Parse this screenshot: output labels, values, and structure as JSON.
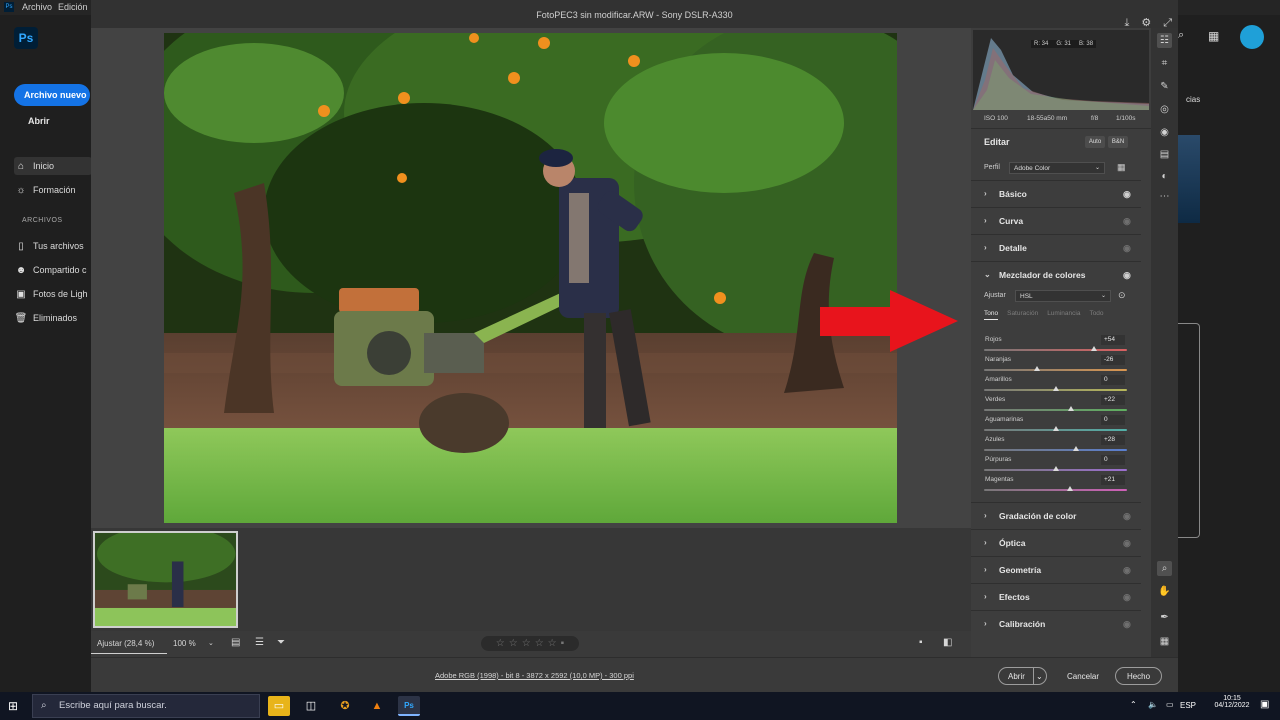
{
  "ps_home": {
    "menu": [
      "Archivo",
      "Edición"
    ],
    "logo": "Ps",
    "new_button": "Archivo nuevo",
    "open_link": "Abrir",
    "nav": [
      {
        "label": "Inicio",
        "icon": "home-icon"
      },
      {
        "label": "Formación",
        "icon": "lightbulb-icon"
      }
    ],
    "files_section": "ARCHIVOS",
    "files": [
      {
        "label": "Tus archivos",
        "icon": "file-icon"
      },
      {
        "label": "Compartido c",
        "icon": "people-icon"
      },
      {
        "label": "Fotos de Ligh",
        "icon": "lightroom-icon"
      },
      {
        "label": "Eliminados",
        "icon": "trash-icon"
      }
    ],
    "right_fragment": "cias"
  },
  "acr": {
    "title": "FotoPEC3 sin modificar.ARW  -  Sony DSLR-A330",
    "histogram": {
      "r": "R: 34",
      "g": "G: 31",
      "b": "B: 38"
    },
    "exif": {
      "iso": "ISO 100",
      "lens": "18-55a50 mm",
      "aperture": "f/8",
      "shutter": "1/100s"
    },
    "edit": {
      "title": "Editar",
      "auto": "Auto",
      "bw": "B&N"
    },
    "profile": {
      "label": "Perfil",
      "value": "Adobe Color"
    },
    "sections_top": [
      {
        "label": "Básico",
        "eye_on": true
      },
      {
        "label": "Curva",
        "eye_on": false
      },
      {
        "label": "Detalle",
        "eye_on": false
      }
    ],
    "mixer": {
      "title": "Mezclador de colores",
      "adjust_label": "Ajustar",
      "adjust_value": "HSL",
      "tabs": [
        "Tono",
        "Saturación",
        "Luminancia",
        "Todo"
      ],
      "active_tab": "Tono",
      "sliders": [
        {
          "name": "Rojos",
          "value": "+54",
          "level": 0.77,
          "track": "#d96060"
        },
        {
          "name": "Naranjas",
          "value": "-26",
          "level": 0.37,
          "track": "#d99650"
        },
        {
          "name": "Amarillos",
          "value": "0",
          "level": 0.5,
          "track": "#b8b85a"
        },
        {
          "name": "Verdes",
          "value": "+22",
          "level": 0.61,
          "track": "#5fb060"
        },
        {
          "name": "Aguamarinas",
          "value": "0",
          "level": 0.5,
          "track": "#52b0a8"
        },
        {
          "name": "Azules",
          "value": "+28",
          "level": 0.64,
          "track": "#5a7fd0"
        },
        {
          "name": "Púrpuras",
          "value": "0",
          "level": 0.5,
          "track": "#9b6fd0"
        },
        {
          "name": "Magentas",
          "value": "+21",
          "level": 0.6,
          "track": "#cf60b8"
        }
      ]
    },
    "sections_bottom": [
      {
        "label": "Gradación de color"
      },
      {
        "label": "Óptica"
      },
      {
        "label": "Geometría"
      },
      {
        "label": "Efectos"
      },
      {
        "label": "Calibración"
      }
    ],
    "bottom_bar": {
      "fit": "Ajustar (28,4 %)",
      "zoom": "100 %"
    },
    "workflow": "Adobe RGB (1998) - bit 8 - 3872 x 2592 (10,0 MP) - 300 ppi",
    "buttons": {
      "open": "Abrir",
      "cancel": "Cancelar",
      "done": "Hecho"
    },
    "arrow_color": "#e8141c"
  },
  "taskbar": {
    "search_placeholder": "Escribe aquí para buscar.",
    "lang": "ESP",
    "time": "10:15",
    "date": "04/12/2022"
  }
}
